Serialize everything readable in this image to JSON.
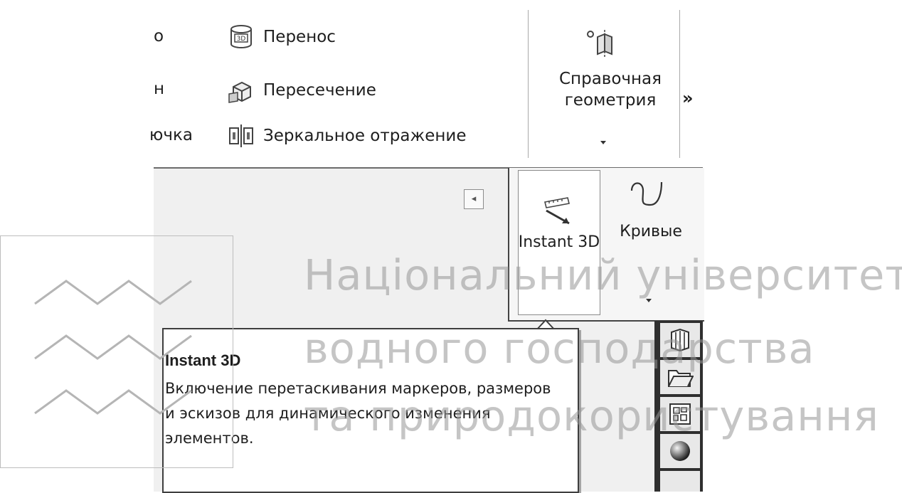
{
  "ribbon": {
    "left_cut": [
      "о",
      "н",
      "ючка"
    ],
    "items": [
      {
        "label": "Перенос",
        "icon": "move-copy-body-icon"
      },
      {
        "label": "Пересечение",
        "icon": "intersect-icon"
      },
      {
        "label": "Зеркальное отражение",
        "icon": "mirror-icon"
      }
    ],
    "reference_geometry": {
      "label": "Справочная геометрия",
      "icon": "reference-geometry-icon"
    },
    "more": "»"
  },
  "flyout": {
    "instant3d_label": "Instant 3D",
    "curves_label": "Кривые"
  },
  "tooltip": {
    "title": "Instant 3D",
    "text": "Включение перетаскивания маркеров, размеров и эскизов для динамического изменения элементов."
  },
  "watermark": {
    "line1": "Національний університет",
    "line2": "водного господарства",
    "line3": "та природокористування"
  }
}
